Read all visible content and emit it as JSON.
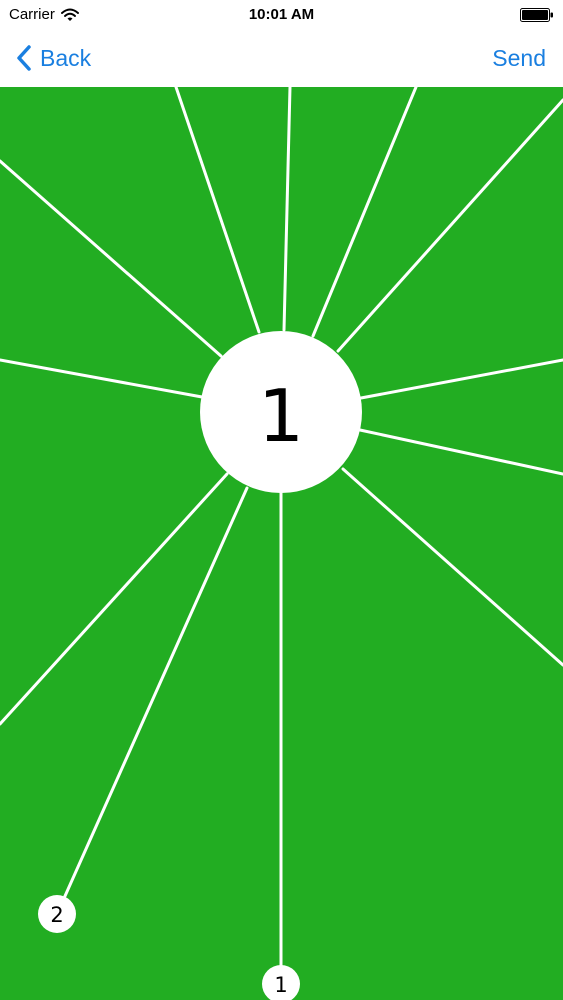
{
  "status_bar": {
    "carrier": "Carrier",
    "time": "10:01 AM"
  },
  "nav": {
    "back_label": "Back",
    "send_label": "Send"
  },
  "canvas": {
    "background_color": "#22ad22",
    "line_color": "#ffffff",
    "center_node_label": "1",
    "marker_labels": [
      "2",
      "1"
    ]
  },
  "colors": {
    "accent": "#1a7fe0"
  },
  "icons": {
    "back": "chevron-left-icon",
    "wifi": "wifi-icon",
    "battery": "battery-icon"
  }
}
